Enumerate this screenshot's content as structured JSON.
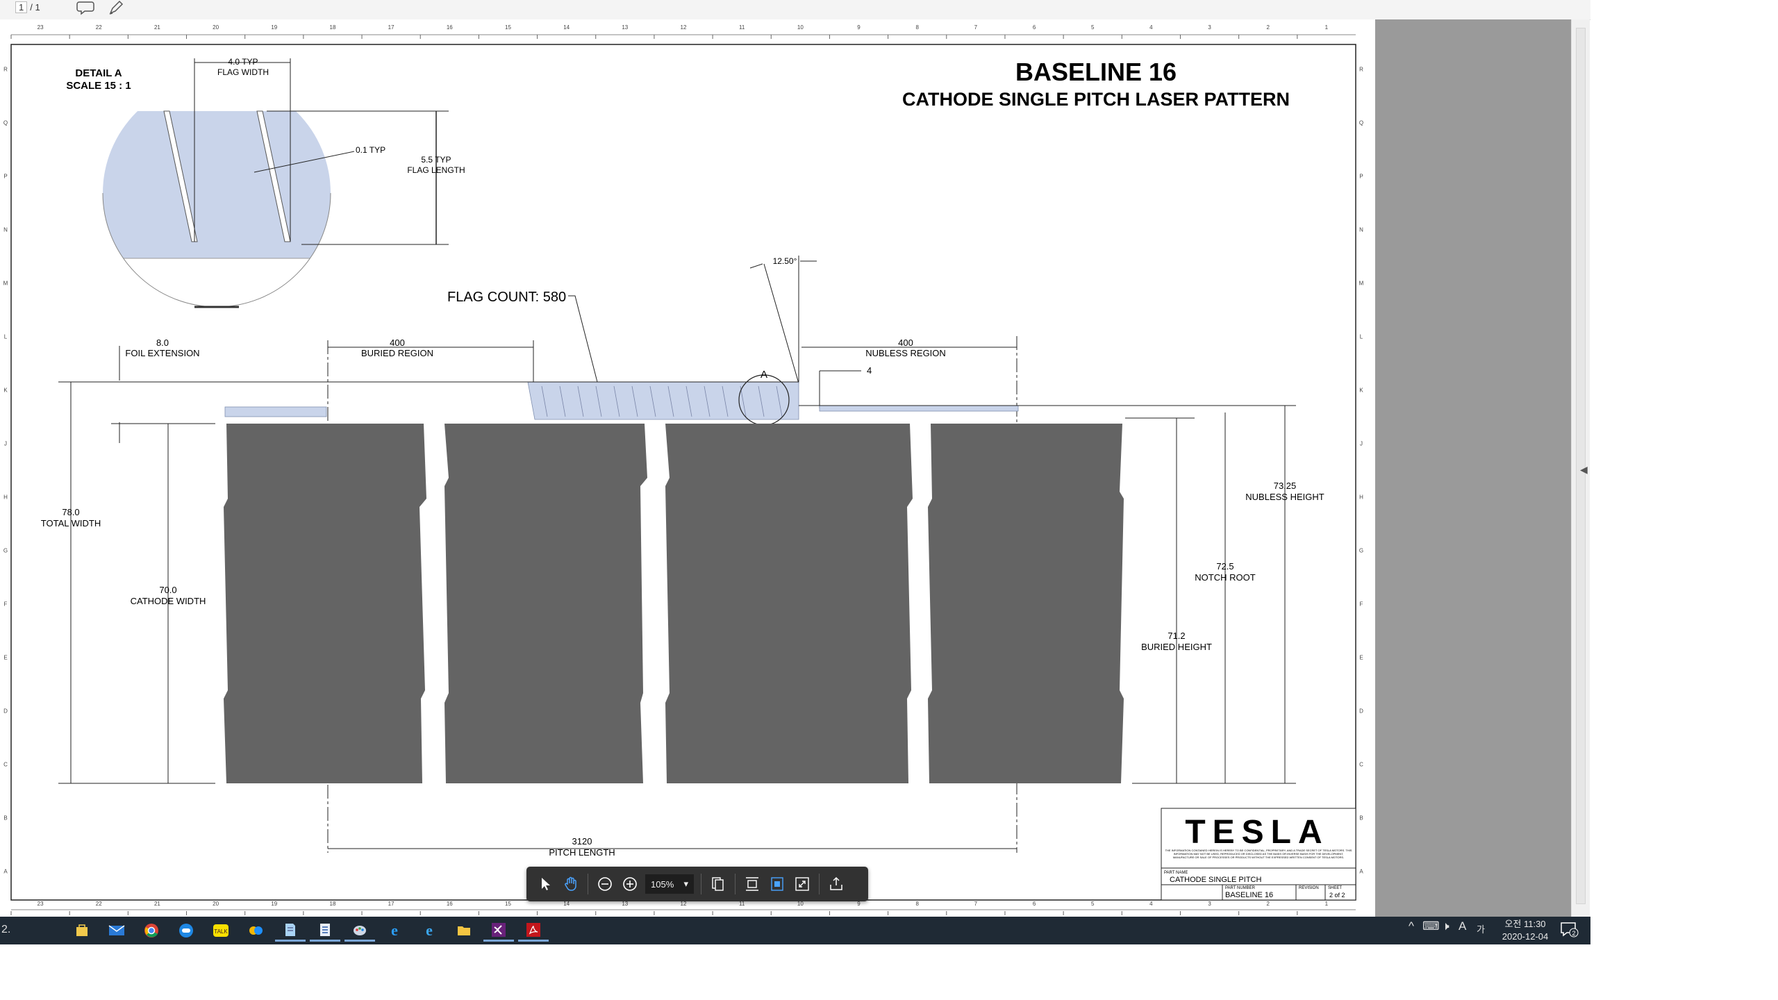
{
  "viewer": {
    "page_current": "1",
    "page_total": "/ 1",
    "zoom": "105%"
  },
  "drawing": {
    "title": "BASELINE 16",
    "subtitle": "CATHODE SINGLE PITCH LASER PATTERN",
    "detail_title": "DETAIL A",
    "detail_scale": "SCALE 15 : 1",
    "flag_width_value": "4.0 TYP",
    "flag_width_label": "FLAG WIDTH",
    "flag_length_value": "5.5 TYP",
    "flag_length_label": "FLAG LENGTH",
    "flag_thickness": "0.1 TYP",
    "flag_count": "FLAG COUNT: 580",
    "angle": "12.50°",
    "foil_ext_value": "8.0",
    "foil_ext_label": "FOIL EXTENSION",
    "buried_region_value": "400",
    "buried_region_label": "BURIED REGION",
    "nubless_region_value": "400",
    "nubless_region_label": "NUBLESS REGION",
    "nub_gap": "4",
    "detail_callout": "A",
    "total_width_value": "78.0",
    "total_width_label": "TOTAL WIDTH",
    "cathode_width_value": "70.0",
    "cathode_width_label": "CATHODE WIDTH",
    "nubless_height_value": "73.25",
    "nubless_height_label": "NUBLESS HEIGHT",
    "notch_root_value": "72.5",
    "notch_root_label": "NOTCH ROOT",
    "buried_height_value": "71.2",
    "buried_height_label": "BURIED HEIGHT",
    "pitch_length_value": "3120",
    "pitch_length_label": "PITCH LENGTH",
    "top_ruler": [
      "23",
      "22",
      "21",
      "20",
      "19",
      "18",
      "17",
      "16",
      "15",
      "14",
      "13",
      "12",
      "11",
      "10",
      "9",
      "8",
      "7",
      "6",
      "5",
      "4",
      "3",
      "2",
      "1"
    ],
    "side_ruler": [
      "R",
      "Q",
      "P",
      "N",
      "M",
      "L",
      "K",
      "J",
      "H",
      "G",
      "F",
      "E",
      "D",
      "C",
      "B",
      "A"
    ],
    "title_block": {
      "logo": "TESLA",
      "confidential": "THE INFORMATION CONTAINED HEREIN IS HEREBY TO BE CONFIDENTIAL, PROPRIETARY, AND A TRADE SECRET OF TESLA MOTORS. THIS INFORMATION MAY NOT BE USED, REPRODUCED OR DISCLOSED AS THE BASIS OR INVERSE BASIS FOR THE DEVELOPMENT, MANUFACTURE OR SALE OF PROCESSES OR PRODUCTS WITHOUT THE EXPRESSED WRITTEN CONSENT OF TESLA MOTORS.",
      "part_name_label": "PART NAME",
      "part_name": "CATHODE SINGLE PITCH",
      "part_number_label": "PART NUMBER",
      "part_number": "BASELINE 16",
      "revision_label": "REVISION",
      "sheet_label": "SHEET",
      "sheet": "2 of 2"
    }
  },
  "taskbar": {
    "left_text": "2.",
    "ime_lang": "A",
    "ime_mode": "가",
    "time": "오전 11:30",
    "date": "2020-12-04",
    "notif_count": "2"
  },
  "colors": {
    "cathode": "#646464",
    "foil": "#c9d4ea",
    "taskbar": "#1f2a35",
    "floatbar": "#323232"
  }
}
